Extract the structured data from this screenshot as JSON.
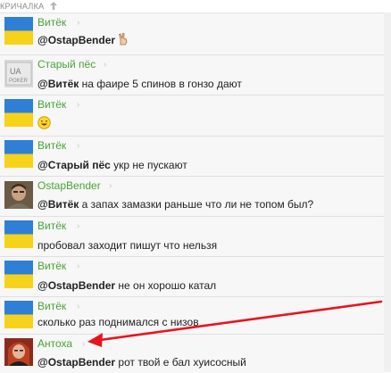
{
  "header": {
    "title": "КРИЧАЛКА",
    "sort_icon": "arrow-up-icon"
  },
  "messages": [
    {
      "author": "Витёк",
      "mention": "@OstapBender",
      "text": "",
      "emoji": "victory-hand-icon",
      "avatar": "ukraine-flag"
    },
    {
      "author": "Старый пёс",
      "mention": "@Витёк",
      "text": "на фаире 5 спинов в гонзо дают",
      "avatar": "ua-poker-logo",
      "avatar_text_top": "UA",
      "avatar_text_bottom": "POKER"
    },
    {
      "author": "Витёк",
      "mention": "",
      "text": "",
      "emoji": "laughing-smiley-icon",
      "avatar": "ukraine-flag"
    },
    {
      "author": "Витёк",
      "mention": "@Старый пёс",
      "text": "укр не пускают",
      "avatar": "ukraine-flag"
    },
    {
      "author": "OstapBender",
      "mention": "@Витёк",
      "text": "а запах замазки раньше что ли не топом был?",
      "avatar": "photo-man"
    },
    {
      "author": "Витёк",
      "mention": "",
      "text": "пробовал заходит пишут что нельзя",
      "avatar": "ukraine-flag"
    },
    {
      "author": "Витёк",
      "mention": "@OstapBender",
      "text": "не он хорошо катал",
      "avatar": "ukraine-flag"
    },
    {
      "author": "Витёк",
      "mention": "",
      "text": "сколько раз поднимался с низов",
      "avatar": "ukraine-flag"
    },
    {
      "author": "Антоха",
      "mention": "@OstapBender",
      "text": "рот твой е бал хуисосный",
      "avatar": "photo-woman"
    }
  ],
  "colors": {
    "author": "#4aa236",
    "annotation_arrow": "#e8141e",
    "flag_blue": "#2f7fd6",
    "flag_yellow": "#f7d21b"
  }
}
